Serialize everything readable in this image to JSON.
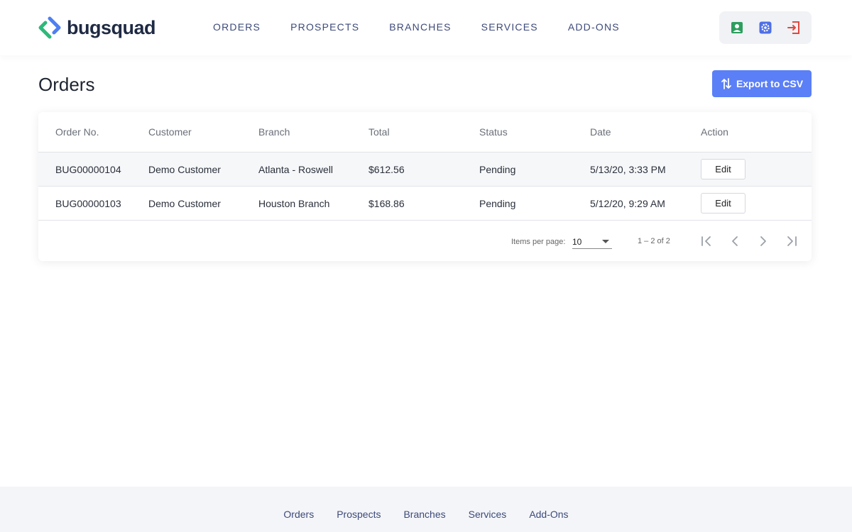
{
  "brand": {
    "name": "bugsquad"
  },
  "nav": {
    "items": [
      "ORDERS",
      "PROSPECTS",
      "BRANCHES",
      "SERVICES",
      "ADD-ONS"
    ]
  },
  "header_icons": [
    {
      "name": "user-profile-icon",
      "color": "#2e9e5f"
    },
    {
      "name": "settings-gear-icon",
      "color": "#4f6fe6"
    },
    {
      "name": "logout-icon",
      "color": "#e0483e"
    }
  ],
  "page": {
    "title": "Orders",
    "export_label": "Export to CSV"
  },
  "table": {
    "headers": [
      "Order No.",
      "Customer",
      "Branch",
      "Total",
      "Status",
      "Date",
      "Action"
    ],
    "rows": [
      {
        "order_no": "BUG00000104",
        "customer": "Demo Customer",
        "branch": "Atlanta - Roswell",
        "total": "$612.56",
        "status": "Pending",
        "date": "5/13/20, 3:33 PM",
        "action": "Edit"
      },
      {
        "order_no": "BUG00000103",
        "customer": "Demo Customer",
        "branch": "Houston Branch",
        "total": "$168.86",
        "status": "Pending",
        "date": "5/12/20, 9:29 AM",
        "action": "Edit"
      }
    ]
  },
  "paginator": {
    "items_per_page_label": "Items per page:",
    "items_per_page_value": "10",
    "range_label": "1 – 2 of 2"
  },
  "footer": {
    "links": [
      "Orders",
      "Prospects",
      "Branches",
      "Services",
      "Add-Ons"
    ]
  },
  "colors": {
    "accent": "#5b7ff7",
    "nav_text": "#3d4a7a",
    "logo_green": "#2eb87a",
    "logo_blue": "#4f7ff0"
  }
}
